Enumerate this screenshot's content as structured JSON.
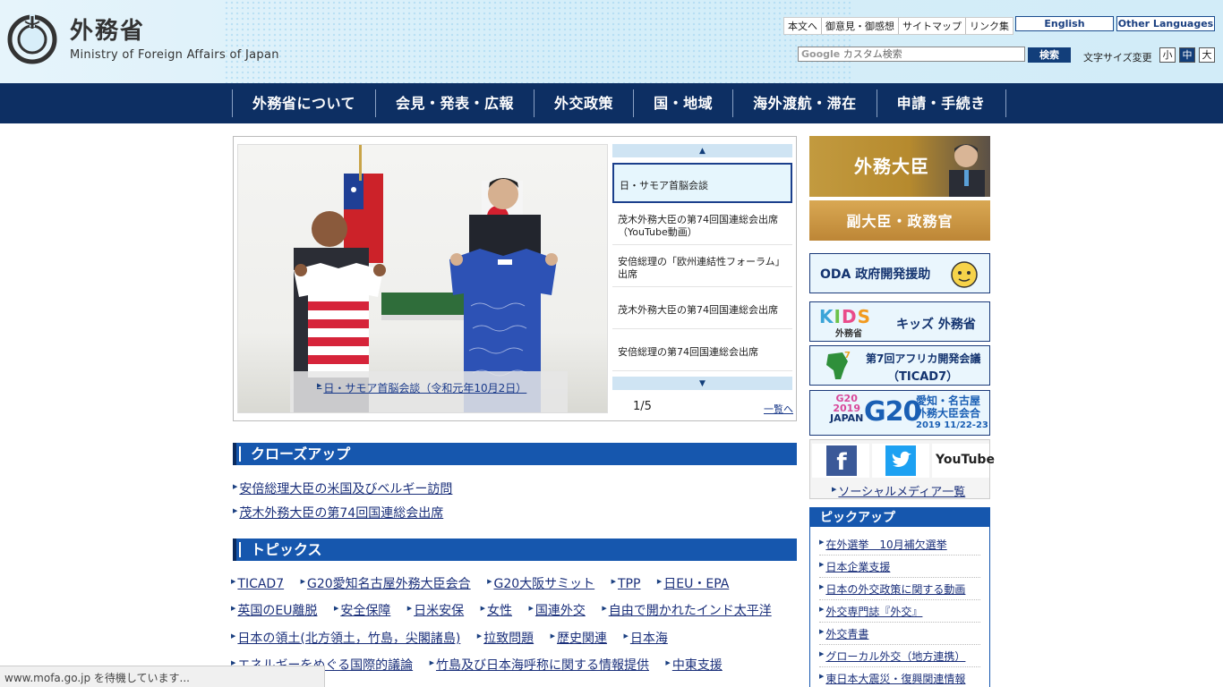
{
  "header": {
    "title_jp": "外務省",
    "title_en": "Ministry of Foreign Affairs of Japan",
    "util_links": [
      "本文へ",
      "御意見・御感想",
      "サイトマップ",
      "リンク集"
    ],
    "english_label": "English",
    "other_lang_label": "Other Languages",
    "search_placeholder": "カスタム検索",
    "search_logo": "Google",
    "search_button": "検索",
    "fontsize_label": "文字サイズ変更",
    "fontsize_options": [
      "小",
      "中",
      "大"
    ],
    "fontsize_active": "中"
  },
  "gnav": [
    "外務省について",
    "会見・発表・広報",
    "外交政策",
    "国・地域",
    "海外渡航・滞在",
    "申請・手続き"
  ],
  "carousel": {
    "photo_caption": "日・サモア首脳会談（令和元年10月2日）",
    "items": [
      "日・サモア首脳会談",
      "茂木外務大臣の第74回国連総会出席（YouTube動画）",
      "安倍総理の「欧州連結性フォーラム」出席",
      "茂木外務大臣の第74回国連総会出席",
      "安倍総理の第74回国連総会出席"
    ],
    "pager": "1/5",
    "list_all": "一覧へ"
  },
  "closeup": {
    "title": "クローズアップ",
    "links": [
      "安倍総理大臣の米国及びベルギー訪問",
      "茂木外務大臣の第74回国連総会出席"
    ]
  },
  "topics": {
    "title": "トピックス",
    "rows": [
      [
        "TICAD7",
        "G20愛知名古屋外務大臣会合",
        "G20大阪サミット",
        "TPP",
        "日EU・EPA"
      ],
      [
        "英国のEU離脱",
        "安全保障",
        "日米安保",
        "女性",
        "国連外交",
        "自由で開かれたインド太平洋"
      ],
      [
        "日本の領土(北方領土，竹島，尖閣諸島)",
        "拉致問題",
        "歴史関連",
        "日本海"
      ],
      [
        "エネルギーをめぐる国際的議論",
        "竹島及び日本海呼称に関する情報提供",
        "中東支援"
      ]
    ]
  },
  "right": {
    "minister": "外務大臣",
    "vice": "副大臣・政務官",
    "oda": "ODA 政府開発援助",
    "kids_logo": "KIDS",
    "kids_sub": "外務省",
    "kids": "キッズ 外務省",
    "ticad_line1": "第7回アフリカ開発会議",
    "ticad_line2": "（TICAD7）",
    "g20_logo": "G20",
    "g20_year": "2019",
    "g20_country": "JAPAN",
    "g20_big": "G20",
    "g20_line1": "愛知・名古屋",
    "g20_line2": "外務大臣会合",
    "g20_date": "2019 11/22-23",
    "youtube": "YouTube",
    "social_link": "ソーシャルメディア一覧",
    "pickup_title": "ピックアップ",
    "pickup_items": [
      "在外選挙　10月補欠選挙",
      "日本企業支援",
      "日本の外交政策に関する動画",
      "外交専門誌『外交』",
      "外交青書",
      "グローカル外交（地方連携）",
      "東日本大震災・復興関連情報"
    ]
  },
  "statusbar": "www.mofa.go.jp を待機しています..."
}
